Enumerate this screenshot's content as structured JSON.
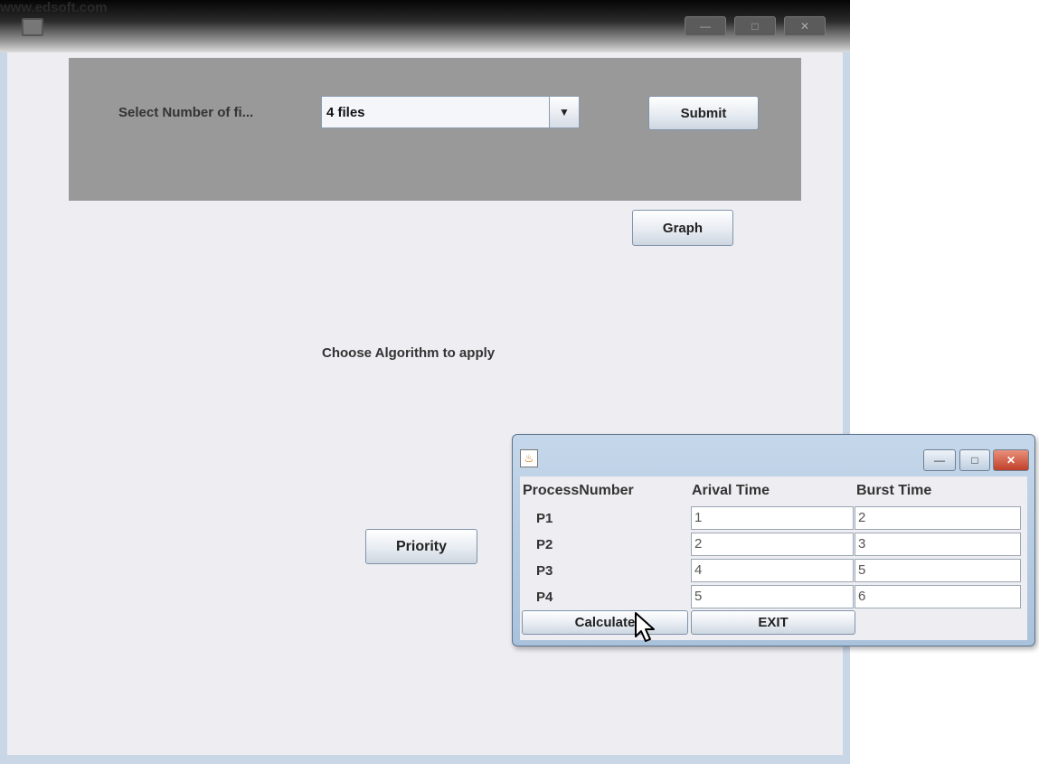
{
  "watermark": "www.edsoft.com",
  "main_window": {
    "title_controls": [
      "—",
      "□",
      "✕"
    ]
  },
  "top_panel": {
    "select_label": "Select Number of fi...",
    "file_count_value": "4 files",
    "submit_label": "Submit"
  },
  "graph_label": "Graph",
  "algorithm_label": "Choose Algorithm to apply",
  "priority_label": "Priority",
  "dialog": {
    "icon": "java-icon",
    "title_controls": [
      "—",
      "□",
      "✕"
    ],
    "headers": [
      "ProcessNumber",
      "Arival Time",
      "Burst Time"
    ],
    "rows": [
      {
        "process": "P1",
        "arrival": "1",
        "burst": "2"
      },
      {
        "process": "P2",
        "arrival": "2",
        "burst": "3"
      },
      {
        "process": "P3",
        "arrival": "4",
        "burst": "5"
      },
      {
        "process": "P4",
        "arrival": "5",
        "burst": "6"
      }
    ],
    "calculate_label": "Calculate",
    "exit_label": "EXIT"
  },
  "colors": {
    "panel_gray": "#999999",
    "window_bg": "#eeeef2",
    "dialog_frame": "#a9c2dc",
    "close_red": "#c0402a"
  }
}
